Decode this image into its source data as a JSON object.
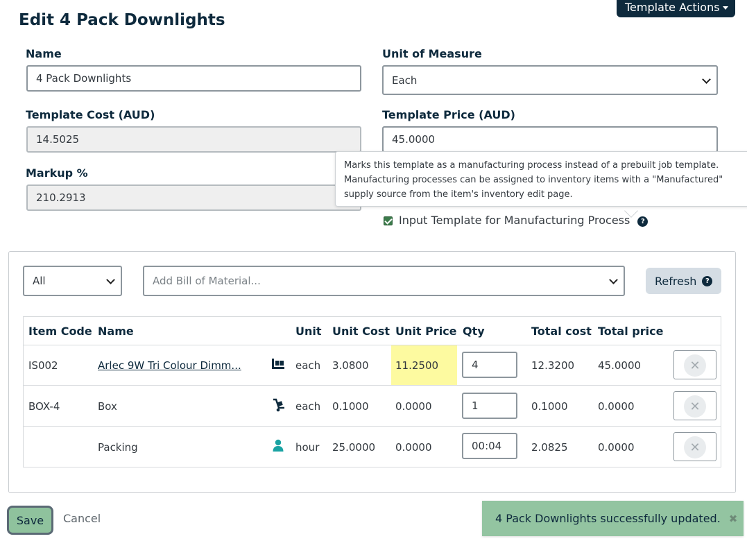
{
  "header": {
    "title": "Edit 4 Pack Downlights",
    "actions_label": "Template Actions"
  },
  "form": {
    "name_label": "Name",
    "name_value": "4 Pack Downlights",
    "uom_label": "Unit of Measure",
    "uom_value": "Each",
    "cost_label": "Template Cost (AUD)",
    "cost_value": "14.5025",
    "price_label": "Template Price (AUD)",
    "price_value": "45.0000",
    "markup_label": "Markup %",
    "markup_value": "210.2913",
    "manufacturing_label": "Input Template for Manufacturing Process",
    "manufacturing_checked": true
  },
  "tooltip": {
    "text": "Marks this template as a manufacturing process instead of a prebuilt job template. Manufacturing processes can be assigned to inventory items with a \"Manufactured\" supply source from the item's inventory edit page."
  },
  "bom": {
    "filter_value": "All",
    "add_placeholder": "Add Bill of Material...",
    "refresh_label": "Refresh",
    "columns": [
      "Item Code",
      "Name",
      "Unit",
      "Unit Cost",
      "Unit Price",
      "Qty",
      "Total cost",
      "Total price"
    ],
    "rows": [
      {
        "code": "IS002",
        "name": "Arlec 9W Tri Colour Dimm...",
        "icon": "forklift-icon",
        "unit": "each",
        "unit_cost": "3.0800",
        "unit_price": "11.2500",
        "qty": "4",
        "total_cost": "12.3200",
        "total_price": "45.0000"
      },
      {
        "code": "BOX-4",
        "name": "Box",
        "icon": "hand-truck-icon",
        "unit": "each",
        "unit_cost": "0.1000",
        "unit_price": "0.0000",
        "qty": "1",
        "total_cost": "0.1000",
        "total_price": "0.0000"
      },
      {
        "code": "",
        "name": "Packing",
        "icon": "person-icon",
        "unit": "hour",
        "unit_cost": "25.0000",
        "unit_price": "0.0000",
        "qty": "00:04",
        "total_cost": "2.0825",
        "total_price": "0.0000"
      }
    ],
    "highlight_color": "#fdfaa0"
  },
  "footer": {
    "save_label": "Save",
    "cancel_label": "Cancel"
  },
  "toast": {
    "message": "4 Pack Downlights successfully updated.",
    "close_glyph": "✖"
  },
  "colors": {
    "navy": "#0e2a3d",
    "teal_icon": "#1aa3a3",
    "save_green": "#8fc29d",
    "toast_green": "#93c4a1"
  }
}
